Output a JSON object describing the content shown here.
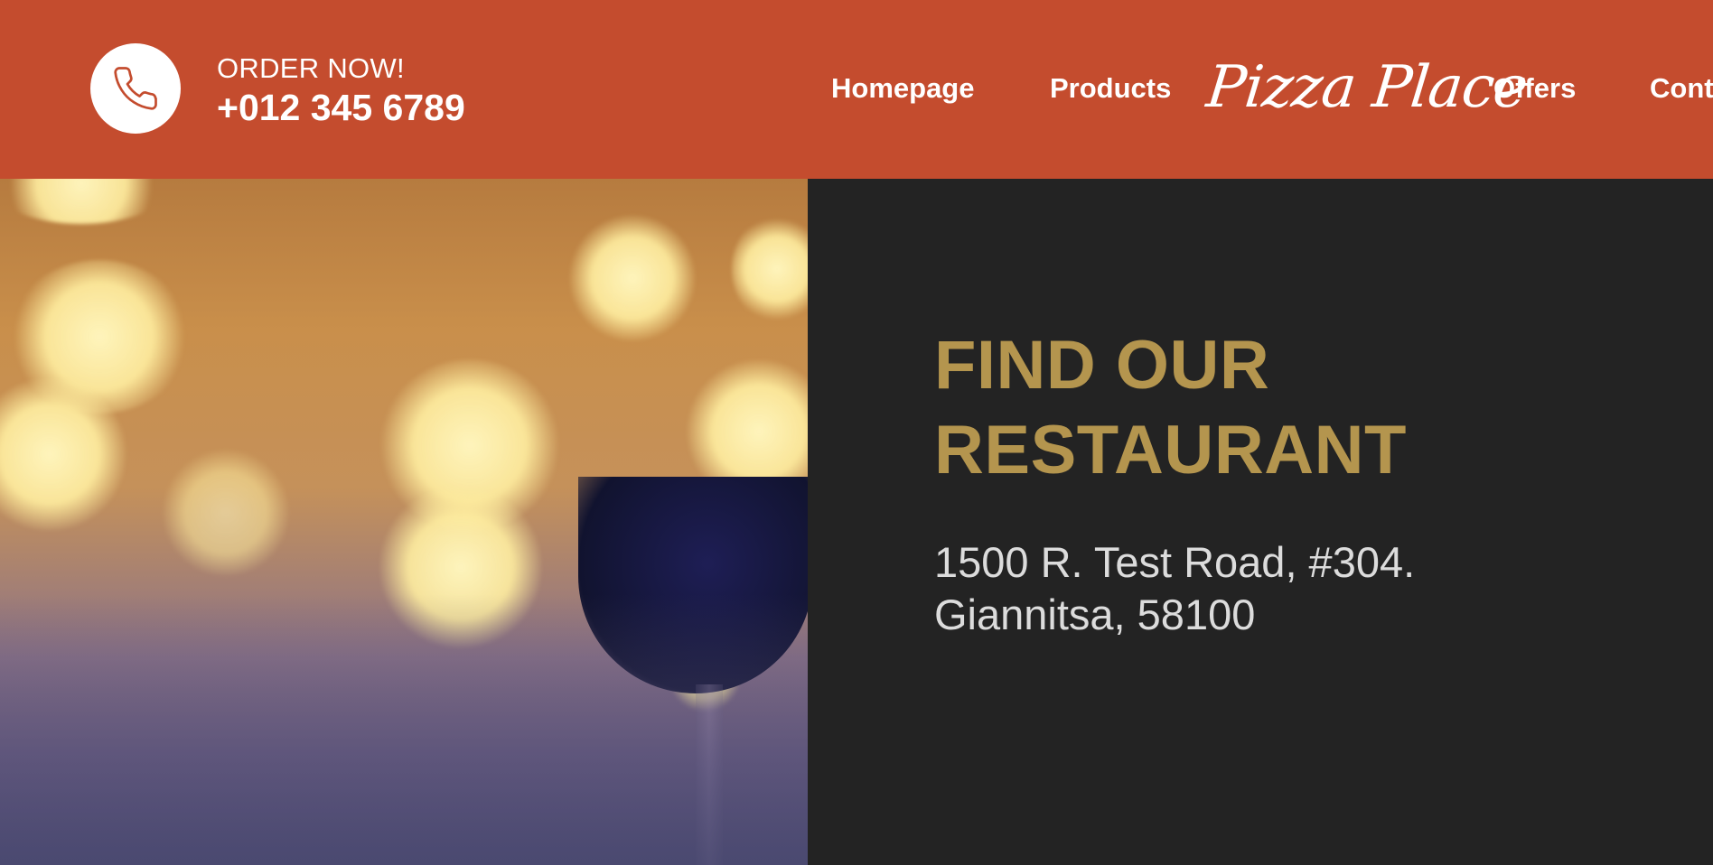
{
  "header": {
    "order_label": "ORDER NOW!",
    "phone_number": "+012 345 6789",
    "phone_icon": "phone-icon",
    "logo_text": "Pizza Place",
    "nav": {
      "home": "Homepage",
      "products": "Products",
      "offers": "Offers",
      "contact": "Cont"
    }
  },
  "location": {
    "title_line1": "FIND OUR",
    "title_line2": "RESTAURANT",
    "address_line1": "1500 R. Test Road, #304.",
    "address_line2": "Giannitsa, 58100"
  },
  "colors": {
    "header_bg": "#c44c2e",
    "panel_bg": "#232323",
    "title_gold": "#b4954e",
    "address_text": "#dcdcdc"
  }
}
